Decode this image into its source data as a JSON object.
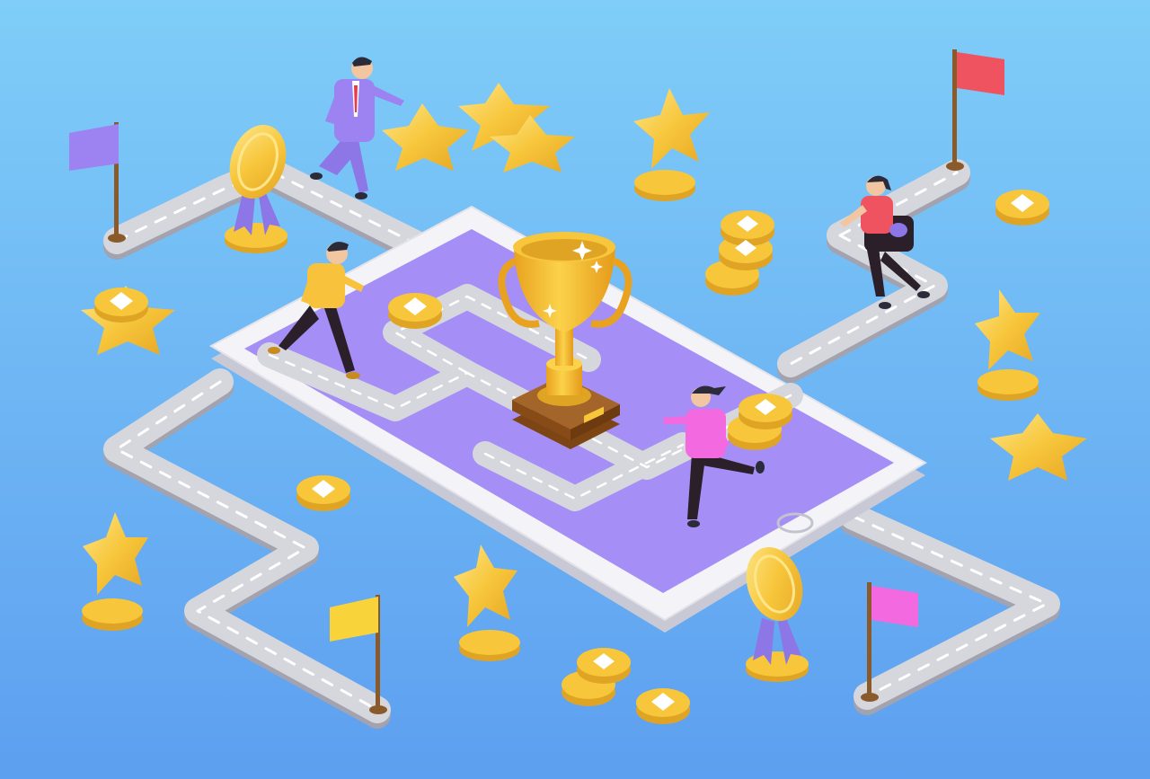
{
  "colors": {
    "bg_top": "#7fcdf8",
    "bg_bottom": "#5d9ff0",
    "road": "#d4d4db",
    "road_side": "#a3a3b0",
    "road_dash": "#ffffff",
    "tablet": "#f4f4f8",
    "tablet_side": "#c9c9d6",
    "screen": "#a58ef6",
    "screen_dark": "#8f78ea",
    "gold": "#f7c63b",
    "gold_light": "#fde68a",
    "gold_dark": "#e0a425",
    "trophy_base": "#9a5a1e",
    "ribbon": "#8d76e6",
    "flag_purple": "#9d82f2",
    "flag_red": "#ef5360",
    "flag_yellow": "#f9d33a",
    "flag_pink": "#f36ae0",
    "pole": "#8a5a2b"
  },
  "icons": [
    "trophy-icon",
    "gold-star-icon",
    "coin-icon",
    "medal-icon",
    "flag-icon",
    "runner-figure"
  ]
}
